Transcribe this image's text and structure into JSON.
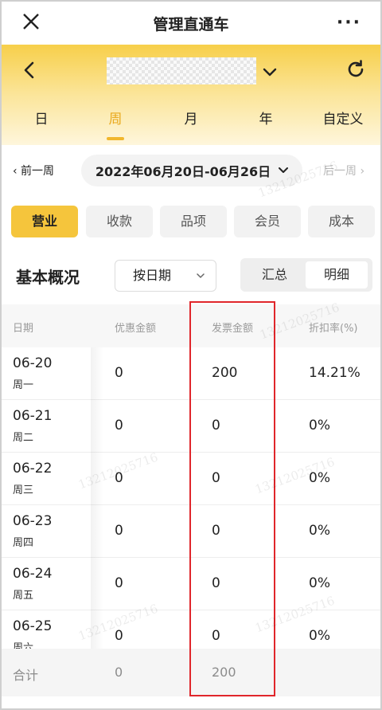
{
  "titlebar": {
    "title": "管理直通车",
    "more": "···"
  },
  "header": {
    "store_name": "",
    "period_tabs": [
      {
        "label": "日",
        "active": false
      },
      {
        "label": "周",
        "active": true
      },
      {
        "label": "月",
        "active": false
      },
      {
        "label": "年",
        "active": false
      },
      {
        "label": "自定义",
        "active": false
      }
    ]
  },
  "date_nav": {
    "prev": "‹ 前一周",
    "range": "2022年06月20日-06月26日",
    "next": "后一周 ›"
  },
  "categories": [
    {
      "label": "营业",
      "active": true
    },
    {
      "label": "收款",
      "active": false
    },
    {
      "label": "品项",
      "active": false
    },
    {
      "label": "会员",
      "active": false
    },
    {
      "label": "成本",
      "active": false
    }
  ],
  "section": {
    "title": "基本概况",
    "group_by": "按日期",
    "view_toggle": [
      {
        "label": "汇总",
        "active": false
      },
      {
        "label": "明细",
        "active": true
      }
    ]
  },
  "table": {
    "headers": [
      "日期",
      "优惠金额",
      "发票金额",
      "折扣率(%)"
    ],
    "rows": [
      {
        "date": "06-20",
        "weekday": "周一",
        "discount": "0",
        "invoice": "200",
        "rate": "14.21%"
      },
      {
        "date": "06-21",
        "weekday": "周二",
        "discount": "0",
        "invoice": "0",
        "rate": "0%"
      },
      {
        "date": "06-22",
        "weekday": "周三",
        "discount": "0",
        "invoice": "0",
        "rate": "0%"
      },
      {
        "date": "06-23",
        "weekday": "周四",
        "discount": "0",
        "invoice": "0",
        "rate": "0%"
      },
      {
        "date": "06-24",
        "weekday": "周五",
        "discount": "0",
        "invoice": "0",
        "rate": "0%"
      },
      {
        "date": "06-25",
        "weekday": "周六",
        "discount": "0",
        "invoice": "0",
        "rate": "0%"
      }
    ],
    "total": {
      "label": "合计",
      "discount": "0",
      "invoice": "200"
    }
  },
  "watermark": "13212025716",
  "colors": {
    "accent": "#f5c53c",
    "active_tab": "#e9a81c",
    "highlight": "#e0262b"
  }
}
